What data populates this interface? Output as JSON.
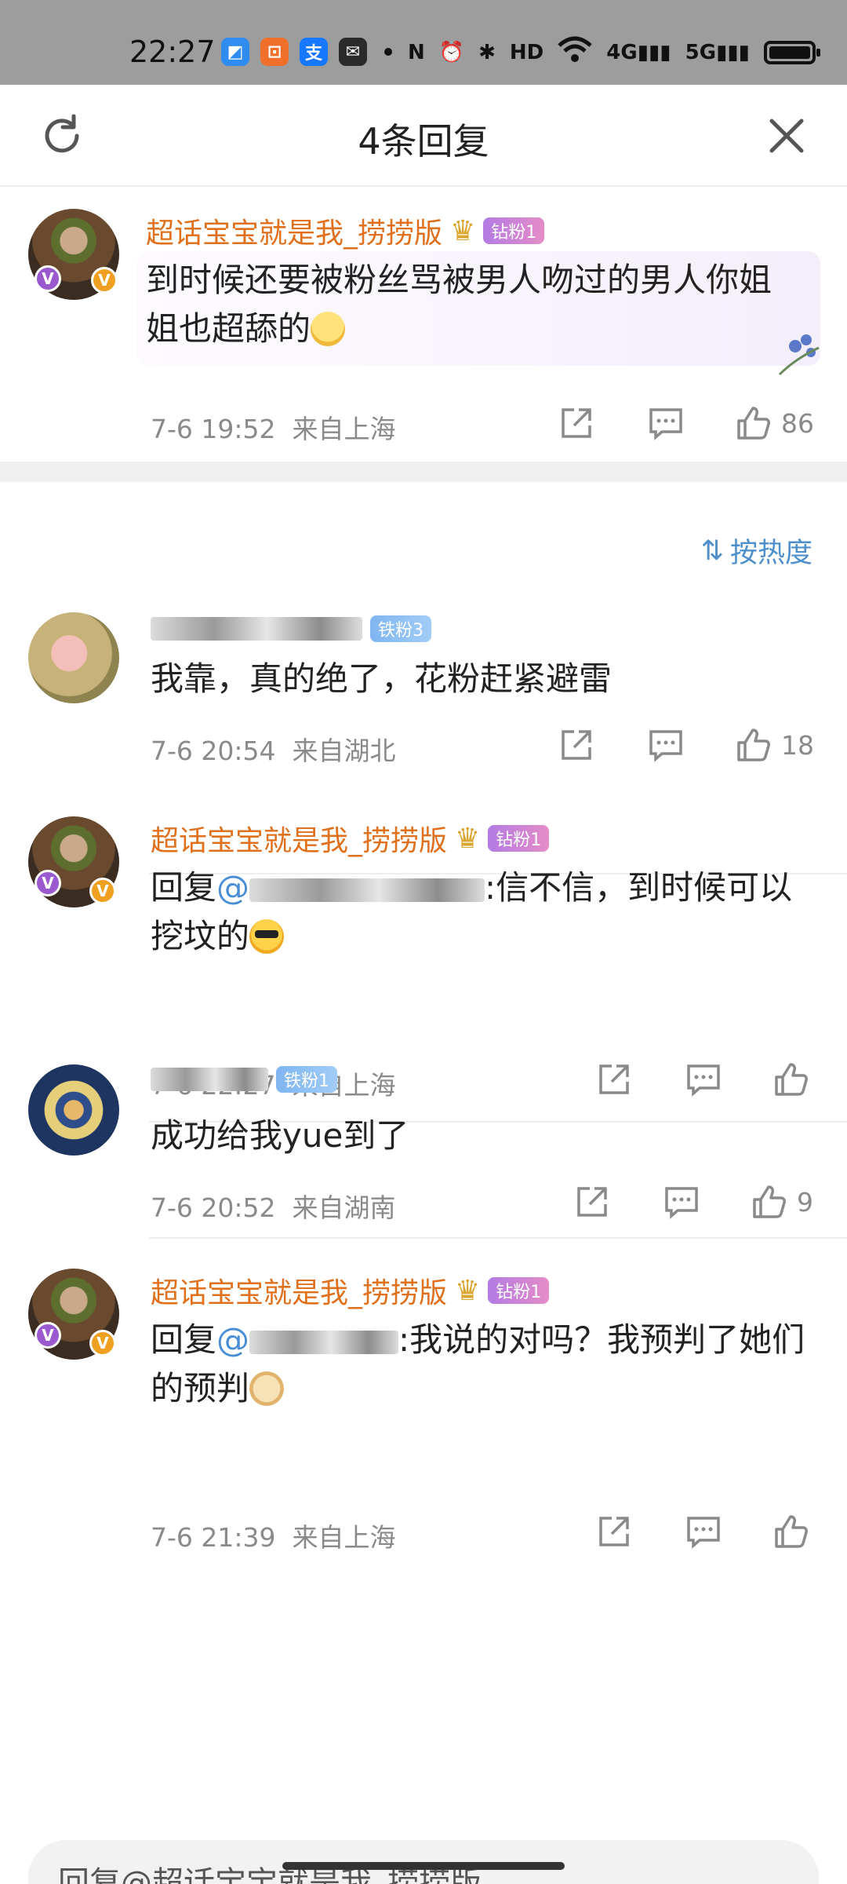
{
  "status_bar": {
    "time": "22:27",
    "app_icons": [
      {
        "icon": "app-blue-icon",
        "glyph": "◩",
        "color": "#2f8cf0"
      },
      {
        "icon": "app-orange-icon",
        "glyph": "⊡",
        "color": "#f06f2a"
      },
      {
        "icon": "alipay-icon",
        "glyph": "支",
        "color": "#1677ff"
      },
      {
        "icon": "wechat-icon",
        "glyph": "✉",
        "color": "#2a2a2a"
      }
    ],
    "right_icons": [
      "nfc-icon",
      "alarm-icon",
      "bluetooth-icon",
      "hd-icon",
      "wifi-icon",
      "signal-4g-icon",
      "signal-5g-icon",
      "battery-icon"
    ],
    "labels": {
      "nfc": "N",
      "hd": "HD",
      "g4": "4G",
      "g5": "5G"
    }
  },
  "header": {
    "title": "4条回复"
  },
  "root_comment": {
    "username": "超话宝宝就是我_捞捞版",
    "badge": "钻粉1",
    "text": "到时候还要被粉丝骂被男人吻过的男人你姐姐也超舔的",
    "date": "7-6 19:52",
    "location": "来自上海",
    "likes": "86"
  },
  "sort": {
    "label": "按热度"
  },
  "replies": [
    {
      "username_visible": "",
      "badge": "铁粉3",
      "text": "我靠，真的绝了，花粉赶紧避雷",
      "date": "7-6 20:54",
      "location": "来自湖北",
      "likes": "18"
    },
    {
      "username": "超话宝宝就是我_捞捞版",
      "badge": "钻粉1",
      "prefix": "回复",
      "mention": "@",
      "text": ":信不信，到时候可以挖坟的",
      "date": "7-6 22:27",
      "location": "来自上海",
      "likes": ""
    },
    {
      "username_visible": "",
      "badge": "铁粉1",
      "text": "成功给我yue到了",
      "date": "7-6 20:52",
      "location": "来自湖南",
      "likes": "9"
    },
    {
      "username": "超话宝宝就是我_捞捞版",
      "badge": "钻粉1",
      "prefix": "回复",
      "mention": "@",
      "text": ":我说的对吗？我预判了她们的预判",
      "date": "7-6 21:39",
      "location": "来自上海",
      "likes": ""
    }
  ],
  "reply_input": {
    "placeholder": "回复@超话宝宝就是我_捞捞版"
  },
  "colors": {
    "username_orange": "#e0701c",
    "link_blue": "#4a8fd6",
    "meta_gray": "#8a8a8a"
  }
}
